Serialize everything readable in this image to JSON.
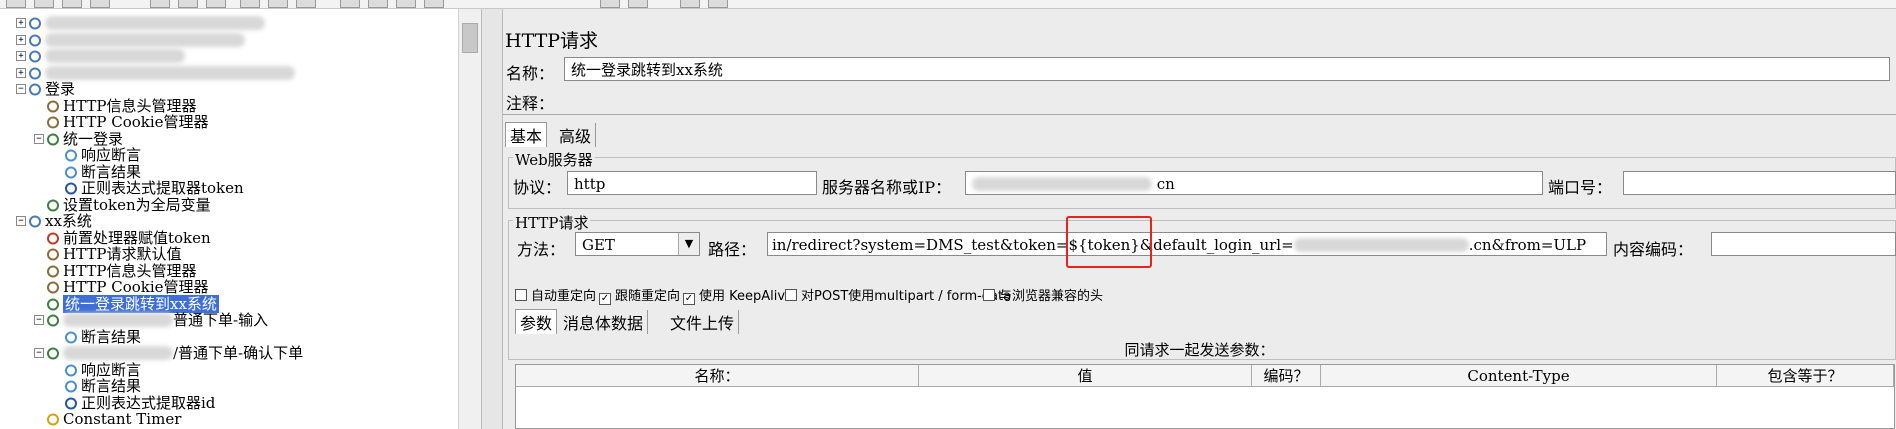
{
  "tree": {
    "nodes": [
      {
        "label": "",
        "level": 0
      },
      {
        "label": "",
        "level": 0
      },
      {
        "label": "",
        "level": 0
      },
      {
        "label": "",
        "level": 0
      },
      {
        "label": "登录",
        "level": 0
      },
      {
        "label": "HTTP信息头管理器",
        "level": 1
      },
      {
        "label": "HTTP Cookie管理器",
        "level": 1
      },
      {
        "label": "统一登录",
        "level": 1
      },
      {
        "label": "响应断言",
        "level": 2
      },
      {
        "label": "断言结果",
        "level": 2
      },
      {
        "label": "正则表达式提取器token",
        "level": 2
      },
      {
        "label": "设置token为全局变量",
        "level": 1
      },
      {
        "label": "xx系统",
        "level": 0
      },
      {
        "label": "前置处理器赋值token",
        "level": 1
      },
      {
        "label": "HTTP请求默认值",
        "level": 1
      },
      {
        "label": "HTTP信息头管理器",
        "level": 1
      },
      {
        "label": "HTTP Cookie管理器",
        "level": 1
      },
      {
        "label": "统一登录跳转到xx系统",
        "level": 1
      },
      {
        "label": "普通下单-输入",
        "level": 1
      },
      {
        "label": "断言结果",
        "level": 2
      },
      {
        "label": "/普通下单-确认下单",
        "level": 1
      },
      {
        "label": "响应断言",
        "level": 2
      },
      {
        "label": "断言结果",
        "level": 2
      },
      {
        "label": "正则表达式提取器id",
        "level": 2
      },
      {
        "label": "Constant Timer",
        "level": 1
      }
    ],
    "selected_label": "统一登录跳转到xx系统"
  },
  "panel": {
    "title": "HTTP请求",
    "name_label": "名称：",
    "name_value": "统一登录跳转到xx系统",
    "comment_label": "注释：",
    "tabs": [
      "基本",
      "高级"
    ],
    "web_server": {
      "title": "Web服务器",
      "protocol_label": "协议：",
      "protocol_value": "http",
      "server_label": "服务器名称或IP：",
      "server_value": "cn",
      "port_label": "端口号："
    },
    "http_request": {
      "title": "HTTP请求",
      "method_label": "方法：",
      "method_value": "GET",
      "path_label": "路径：",
      "path_value_pre": "in/redirect?system=DMS_test&token=",
      "path_value_token": "${token}",
      "path_value_post": "&default_login_url=",
      "path_value_tail": ".cn&from=ULP",
      "encoding_label": "内容编码："
    },
    "options": [
      {
        "label": "自动重定向",
        "checked": false
      },
      {
        "label": "跟随重定向",
        "checked": true
      },
      {
        "label": "使用 KeepAlive",
        "checked": true
      },
      {
        "label": "对POST使用multipart / form-data",
        "checked": false
      },
      {
        "label": "与浏览器兼容的头",
        "checked": false
      }
    ],
    "sub_tabs": [
      "参数",
      "消息体数据",
      "文件上传"
    ],
    "params_caption": "同请求一起发送参数：",
    "columns": [
      "名称：",
      "值",
      "编码？",
      "Content-Type",
      "包含等于？"
    ]
  },
  "colors": {
    "selection": "#3d6fd6",
    "highlight": "#e8231b"
  }
}
